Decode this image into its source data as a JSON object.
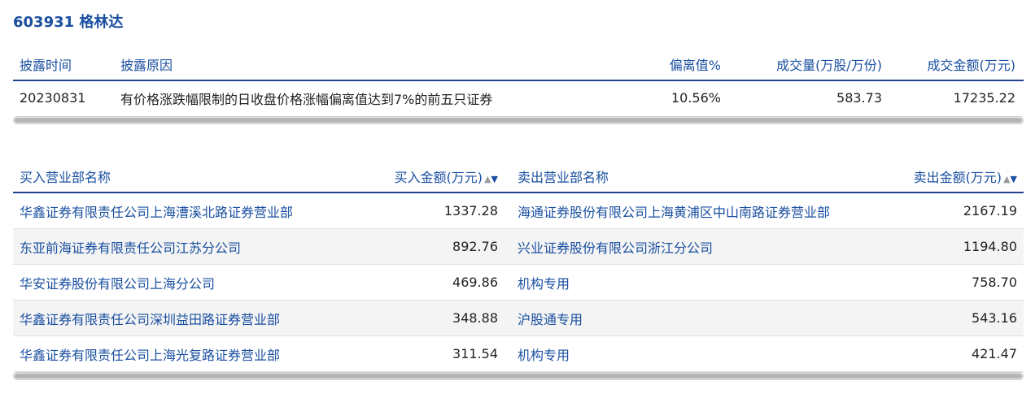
{
  "title": "603931 格林达",
  "disclosure": {
    "headers": {
      "date": "披露时间",
      "reason": "披露原因",
      "deviation": "偏离值%",
      "volume": "成交量(万股/万份)",
      "amount": "成交金额(万元)"
    },
    "rows": [
      {
        "date": "20230831",
        "reason": "有价格涨跌幅限制的日收盘价格涨幅偏离值达到7%的前五只证券",
        "deviation": "10.56%",
        "volume": "583.73",
        "amount": "17235.22"
      }
    ]
  },
  "trades": {
    "headers": {
      "buy_name": "买入营业部名称",
      "buy_amount": "买入金额(万元)",
      "sell_name": "卖出营业部名称",
      "sell_amount": "卖出金额(万元)",
      "sort_up": "▲",
      "sort_down": "▼"
    },
    "rows": [
      {
        "buy_name": "华鑫证券有限责任公司上海漕溪北路证券营业部",
        "buy_amount": "1337.28",
        "sell_name": "海通证券股份有限公司上海黄浦区中山南路证券营业部",
        "sell_amount": "2167.19"
      },
      {
        "buy_name": "东亚前海证券有限责任公司江苏分公司",
        "buy_amount": "892.76",
        "sell_name": "兴业证券股份有限公司浙江分公司",
        "sell_amount": "1194.80"
      },
      {
        "buy_name": "华安证券股份有限公司上海分公司",
        "buy_amount": "469.86",
        "sell_name": "机构专用",
        "sell_amount": "758.70"
      },
      {
        "buy_name": "华鑫证券有限责任公司深圳益田路证券营业部",
        "buy_amount": "348.88",
        "sell_name": "沪股通专用",
        "sell_amount": "543.16"
      },
      {
        "buy_name": "华鑫证券有限责任公司上海光复路证券营业部",
        "buy_amount": "311.54",
        "sell_name": "机构专用",
        "sell_amount": "421.47"
      }
    ]
  }
}
